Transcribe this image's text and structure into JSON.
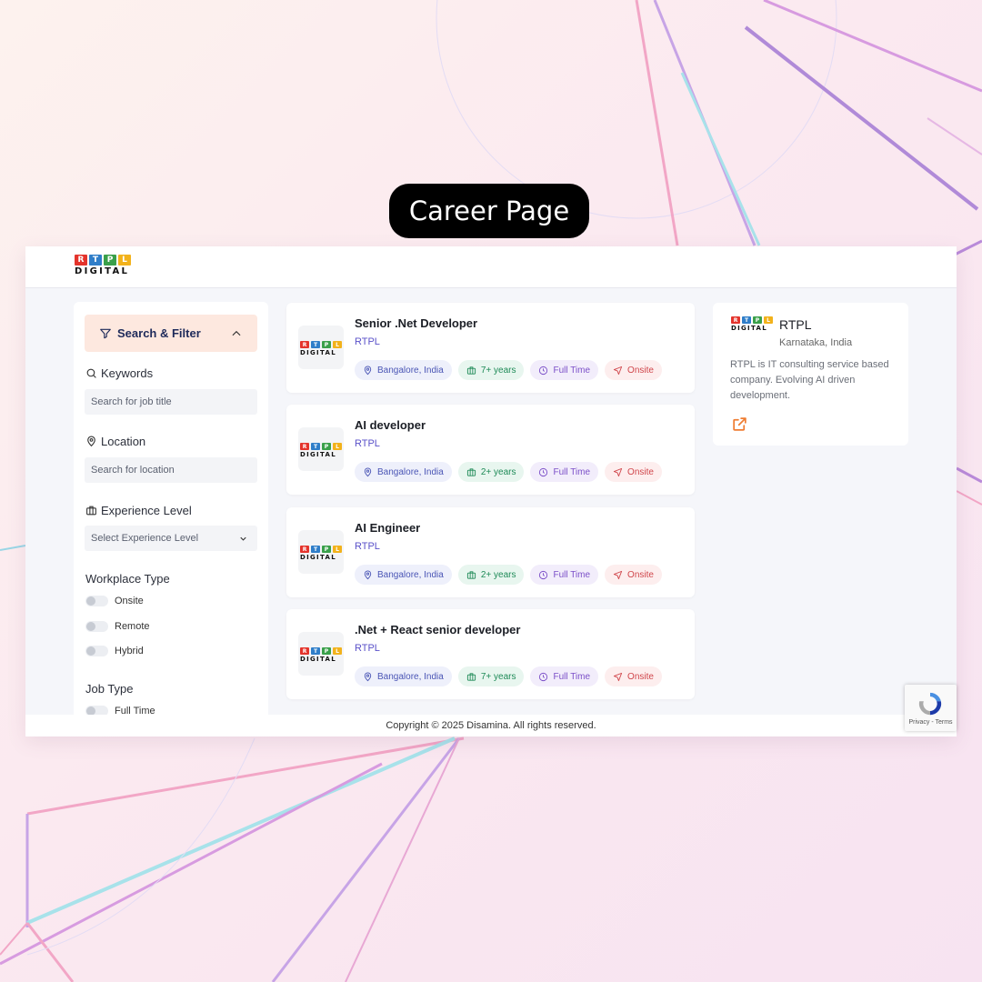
{
  "banner": {
    "title": "Career Page"
  },
  "brand": {
    "logo_letters": [
      "R",
      "T",
      "P",
      "L"
    ],
    "logo_word": "DIGITAL"
  },
  "sidebar": {
    "header": "Search & Filter",
    "keywords": {
      "label": "Keywords",
      "placeholder": "Search for job title"
    },
    "location": {
      "label": "Location",
      "placeholder": "Search for location"
    },
    "experience": {
      "label": "Experience Level",
      "placeholder": "Select Experience Level"
    },
    "workplace": {
      "label": "Workplace Type",
      "options": [
        "Onsite",
        "Remote",
        "Hybrid"
      ]
    },
    "job_type": {
      "label": "Job Type",
      "options": [
        "Full Time"
      ]
    }
  },
  "jobs": [
    {
      "title": "Senior .Net Developer",
      "company": "RTPL",
      "location": "Bangalore, India",
      "experience": "7+ years",
      "type": "Full Time",
      "workplace": "Onsite"
    },
    {
      "title": "AI developer",
      "company": "RTPL",
      "location": "Bangalore, India",
      "experience": "2+ years",
      "type": "Full Time",
      "workplace": "Onsite"
    },
    {
      "title": "AI Engineer",
      "company": "RTPL",
      "location": "Bangalore, India",
      "experience": "2+ years",
      "type": "Full Time",
      "workplace": "Onsite"
    },
    {
      "title": ".Net + React senior developer",
      "company": "RTPL",
      "location": "Bangalore, India",
      "experience": "7+ years",
      "type": "Full Time",
      "workplace": "Onsite"
    }
  ],
  "company": {
    "name": "RTPL",
    "location": "Karnataka, India",
    "description": "RTPL is IT consulting service based company. Evolving AI driven development."
  },
  "footer": {
    "copyright": "Copyright © 2025 Disamina. All rights reserved."
  },
  "recaptcha": {
    "text": "Privacy - Terms"
  },
  "colors": {
    "accent_filter_bg": "#fde8df",
    "company_link": "#5b52c9",
    "external_link_icon": "#ef7d32",
    "logo_red": "#e4342c",
    "logo_blue": "#2f7ec9",
    "logo_green": "#3aa04a",
    "logo_yellow": "#f2b21b"
  },
  "icons": {
    "filter": "funnel-icon",
    "collapse": "chevron-up-icon",
    "keywords": "search-icon",
    "location": "map-pin-icon",
    "experience": "briefcase-icon",
    "select": "chevron-down-icon",
    "tag_location": "map-pin-icon",
    "tag_experience": "briefcase-icon",
    "tag_type": "clock-icon",
    "tag_workplace": "navigation-arrow-icon",
    "company_link": "external-link-icon"
  }
}
